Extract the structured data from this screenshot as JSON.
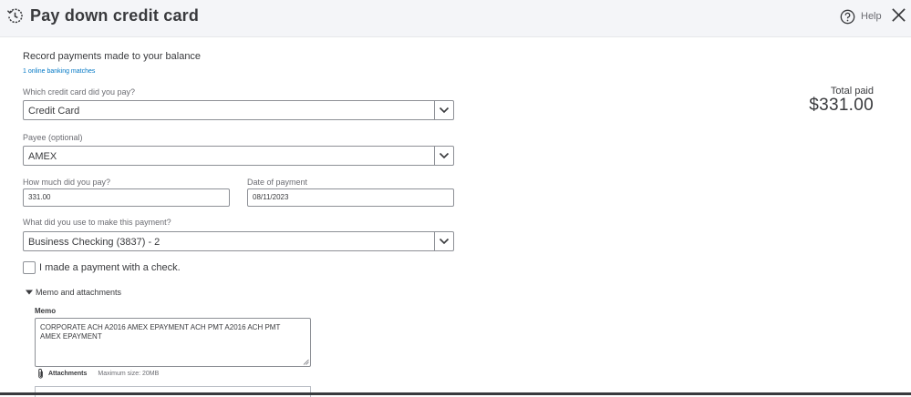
{
  "header": {
    "title": "Pay down credit card",
    "help_label": "Help"
  },
  "intro": {
    "text": "Record payments made to your balance",
    "bank_matches": "1 online banking matches"
  },
  "form": {
    "credit_card": {
      "label": "Which credit card did you pay?",
      "value": "Credit Card"
    },
    "payee": {
      "label": "Payee (optional)",
      "value": "AMEX"
    },
    "amount": {
      "label": "How much did you pay?",
      "value": "331.00"
    },
    "date": {
      "label": "Date of payment",
      "value": "08/11/2023"
    },
    "account": {
      "label": "What did you use to make this payment?",
      "value": "Business Checking (3837) - 2"
    },
    "check_label": "I made a payment with a check.",
    "check_checked": false
  },
  "memo_section": {
    "toggle_label": "Memo and attachments",
    "memo_label": "Memo",
    "memo_text": "CORPORATE ACH A2016 AMEX EPAYMENT ACH PMT A2016 ACH PMT AMEX EPAYMENT",
    "attachments_label": "Attachments",
    "max_size": "Maximum size: 20MB"
  },
  "summary": {
    "total_label": "Total paid",
    "total_amount": "$331.00"
  },
  "colors": {
    "header_bg": "#f4f5f8",
    "link": "#0077c5",
    "text": "#393a3d",
    "border": "#8d9096"
  },
  "icons": [
    "history-icon",
    "help-icon",
    "close-icon",
    "chevron-down-icon",
    "caret-down-icon",
    "paperclip-icon"
  ]
}
